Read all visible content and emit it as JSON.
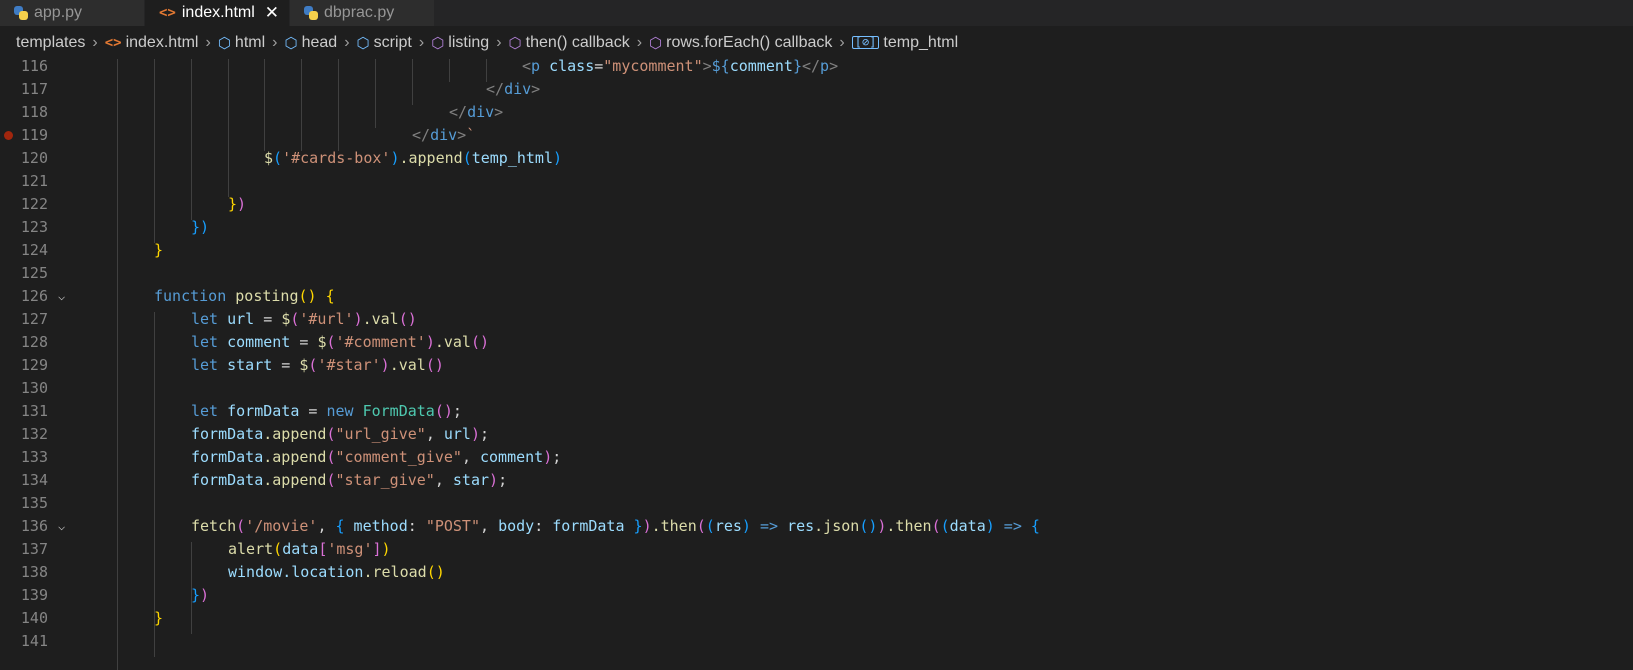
{
  "tabs": [
    {
      "label": "app.py",
      "icon": "python-icon",
      "active": false
    },
    {
      "label": "index.html",
      "icon": "html-icon",
      "active": true,
      "close": "✕"
    },
    {
      "label": "dbprac.py",
      "icon": "python-icon",
      "active": false
    }
  ],
  "breadcrumb": {
    "folder": "templates",
    "file": "index.html",
    "html": "html",
    "head": "head",
    "script": "script",
    "listing": "listing",
    "then_cb": "then() callback",
    "foreach_cb": "rows.forEach() callback",
    "temp": "temp_html"
  },
  "code": {
    "l116": {
      "num": "116",
      "t1": "<",
      "t2": "p",
      "t3": " class",
      "t4": "=",
      "t5": "\"mycomment\"",
      "t6": ">",
      "t7": "${",
      "t8": "comment",
      "t9": "}",
      "t10": "</",
      "t11": "p",
      "t12": ">"
    },
    "l117": {
      "num": "117",
      "t1": "</",
      "t2": "div",
      "t3": ">"
    },
    "l118": {
      "num": "118",
      "t1": "</",
      "t2": "div",
      "t3": ">"
    },
    "l119": {
      "num": "119",
      "t1": "</",
      "t2": "div",
      "t3": ">",
      "t4": "`"
    },
    "l120": {
      "num": "120",
      "t1": "$",
      "t2": "(",
      "t3": "'#cards-box'",
      "t4": ")",
      "t5": ".append",
      "t6": "(",
      "t7": "temp_html",
      "t8": ")"
    },
    "l121": {
      "num": "121"
    },
    "l122": {
      "num": "122",
      "t1": "}",
      "t2": ")"
    },
    "l123": {
      "num": "123",
      "t1": "}",
      "t2": ")"
    },
    "l124": {
      "num": "124",
      "t1": "}"
    },
    "l125": {
      "num": "125"
    },
    "l126": {
      "num": "126",
      "t1": "function",
      "t2": " posting",
      "t3": "(",
      "t4": ")",
      "t5": " {"
    },
    "l127": {
      "num": "127",
      "t1": "let",
      "t2": " url",
      "t3": " = ",
      "t4": "$",
      "t5": "(",
      "t6": "'#url'",
      "t7": ")",
      "t8": ".val",
      "t9": "(",
      "t10": ")"
    },
    "l128": {
      "num": "128",
      "t1": "let",
      "t2": " comment",
      "t3": " = ",
      "t4": "$",
      "t5": "(",
      "t6": "'#comment'",
      "t7": ")",
      "t8": ".val",
      "t9": "(",
      "t10": ")"
    },
    "l129": {
      "num": "129",
      "t1": "let",
      "t2": " start",
      "t3": " = ",
      "t4": "$",
      "t5": "(",
      "t6": "'#star'",
      "t7": ")",
      "t8": ".val",
      "t9": "(",
      "t10": ")"
    },
    "l130": {
      "num": "130"
    },
    "l131": {
      "num": "131",
      "t1": "let",
      "t2": " formData",
      "t3": " = ",
      "t4": "new",
      "t5": " FormData",
      "t6": "(",
      "t7": ")",
      "t8": ";"
    },
    "l132": {
      "num": "132",
      "t1": "formData",
      "t2": ".append",
      "t3": "(",
      "t4": "\"url_give\"",
      "t5": ", ",
      "t6": "url",
      "t7": ")",
      "t8": ";"
    },
    "l133": {
      "num": "133",
      "t1": "formData",
      "t2": ".append",
      "t3": "(",
      "t4": "\"comment_give\"",
      "t5": ", ",
      "t6": "comment",
      "t7": ")",
      "t8": ";"
    },
    "l134": {
      "num": "134",
      "t1": "formData",
      "t2": ".append",
      "t3": "(",
      "t4": "\"star_give\"",
      "t5": ", ",
      "t6": "star",
      "t7": ")",
      "t8": ";"
    },
    "l135": {
      "num": "135"
    },
    "l136": {
      "num": "136",
      "t1": "fetch",
      "t2": "(",
      "t3": "'/movie'",
      "t4": ", ",
      "t5": "{",
      "t6": " method",
      "t7": ": ",
      "t8": "\"POST\"",
      "t9": ", ",
      "t10": "body",
      "t11": ": ",
      "t12": "formData",
      "t13": " }",
      "t14": ")",
      "t15": ".then",
      "t16": "(",
      "t17": "(",
      "t18": "res",
      "t19": ")",
      "t20": " => ",
      "t21": "res",
      "t22": ".json",
      "t23": "(",
      "t24": ")",
      "t25": ")",
      "t26": ".then",
      "t27": "(",
      "t28": "(",
      "t29": "data",
      "t30": ")",
      "t31": " => ",
      "t32": "{"
    },
    "l137": {
      "num": "137",
      "t1": "alert",
      "t2": "(",
      "t3": "data",
      "t4": "[",
      "t5": "'msg'",
      "t6": "]",
      "t7": ")"
    },
    "l138": {
      "num": "138",
      "t1": "window",
      "t2": ".location",
      "t3": ".reload",
      "t4": "(",
      "t5": ")"
    },
    "l139": {
      "num": "139",
      "t1": "}",
      "t2": ")"
    },
    "l140": {
      "num": "140",
      "t1": "}"
    },
    "l141": {
      "num": "141"
    }
  },
  "fold_glyph": "⌵"
}
